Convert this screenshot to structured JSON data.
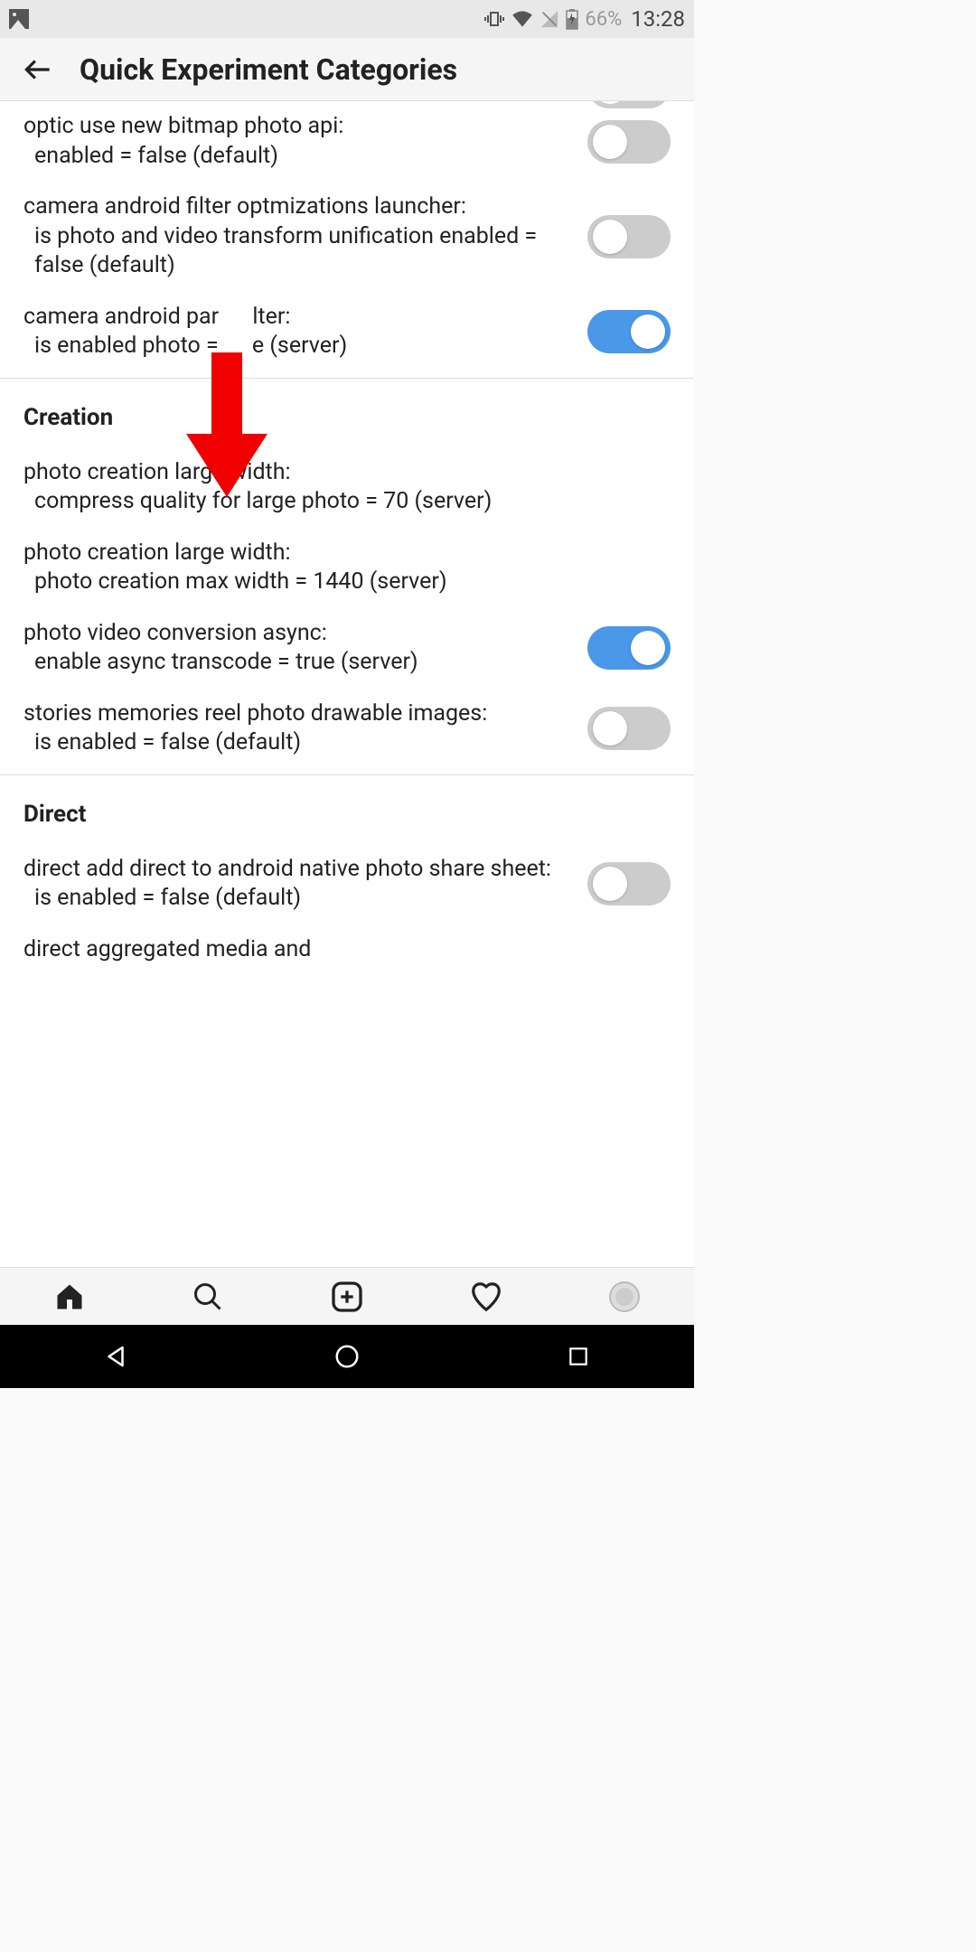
{
  "status_bar": {
    "battery_percent": "66%",
    "time": "13:28"
  },
  "header": {
    "title": "Quick Experiment Categories"
  },
  "section1": {
    "items": [
      {
        "title": "optic use new bitmap photo api:",
        "detail": "enabled = false (default)",
        "toggle": false
      },
      {
        "title": "camera android filter optmizations launcher:",
        "detail": "is photo and video transform unification enabled = false (default)",
        "toggle": false
      },
      {
        "title": "camera android par      lter:",
        "detail": "is enabled photo =      e (server)",
        "toggle": true
      }
    ]
  },
  "section2": {
    "header": "Creation",
    "items": [
      {
        "title": "photo creation large width:",
        "detail": "compress quality for large photo = 70 (server)"
      },
      {
        "title": "photo creation large width:",
        "detail": "photo creation max width = 1440 (server)"
      },
      {
        "title": "photo video conversion async:",
        "detail": "enable async transcode = true (server)",
        "toggle": true
      },
      {
        "title": "stories memories reel photo drawable images:",
        "detail": "is enabled = false (default)",
        "toggle": false
      }
    ]
  },
  "section3": {
    "header": "Direct",
    "items": [
      {
        "title": "direct add direct to android native photo share sheet:",
        "detail": "is enabled = false (default)",
        "toggle": false
      },
      {
        "title_partial": "direct aggregated media and"
      }
    ]
  }
}
